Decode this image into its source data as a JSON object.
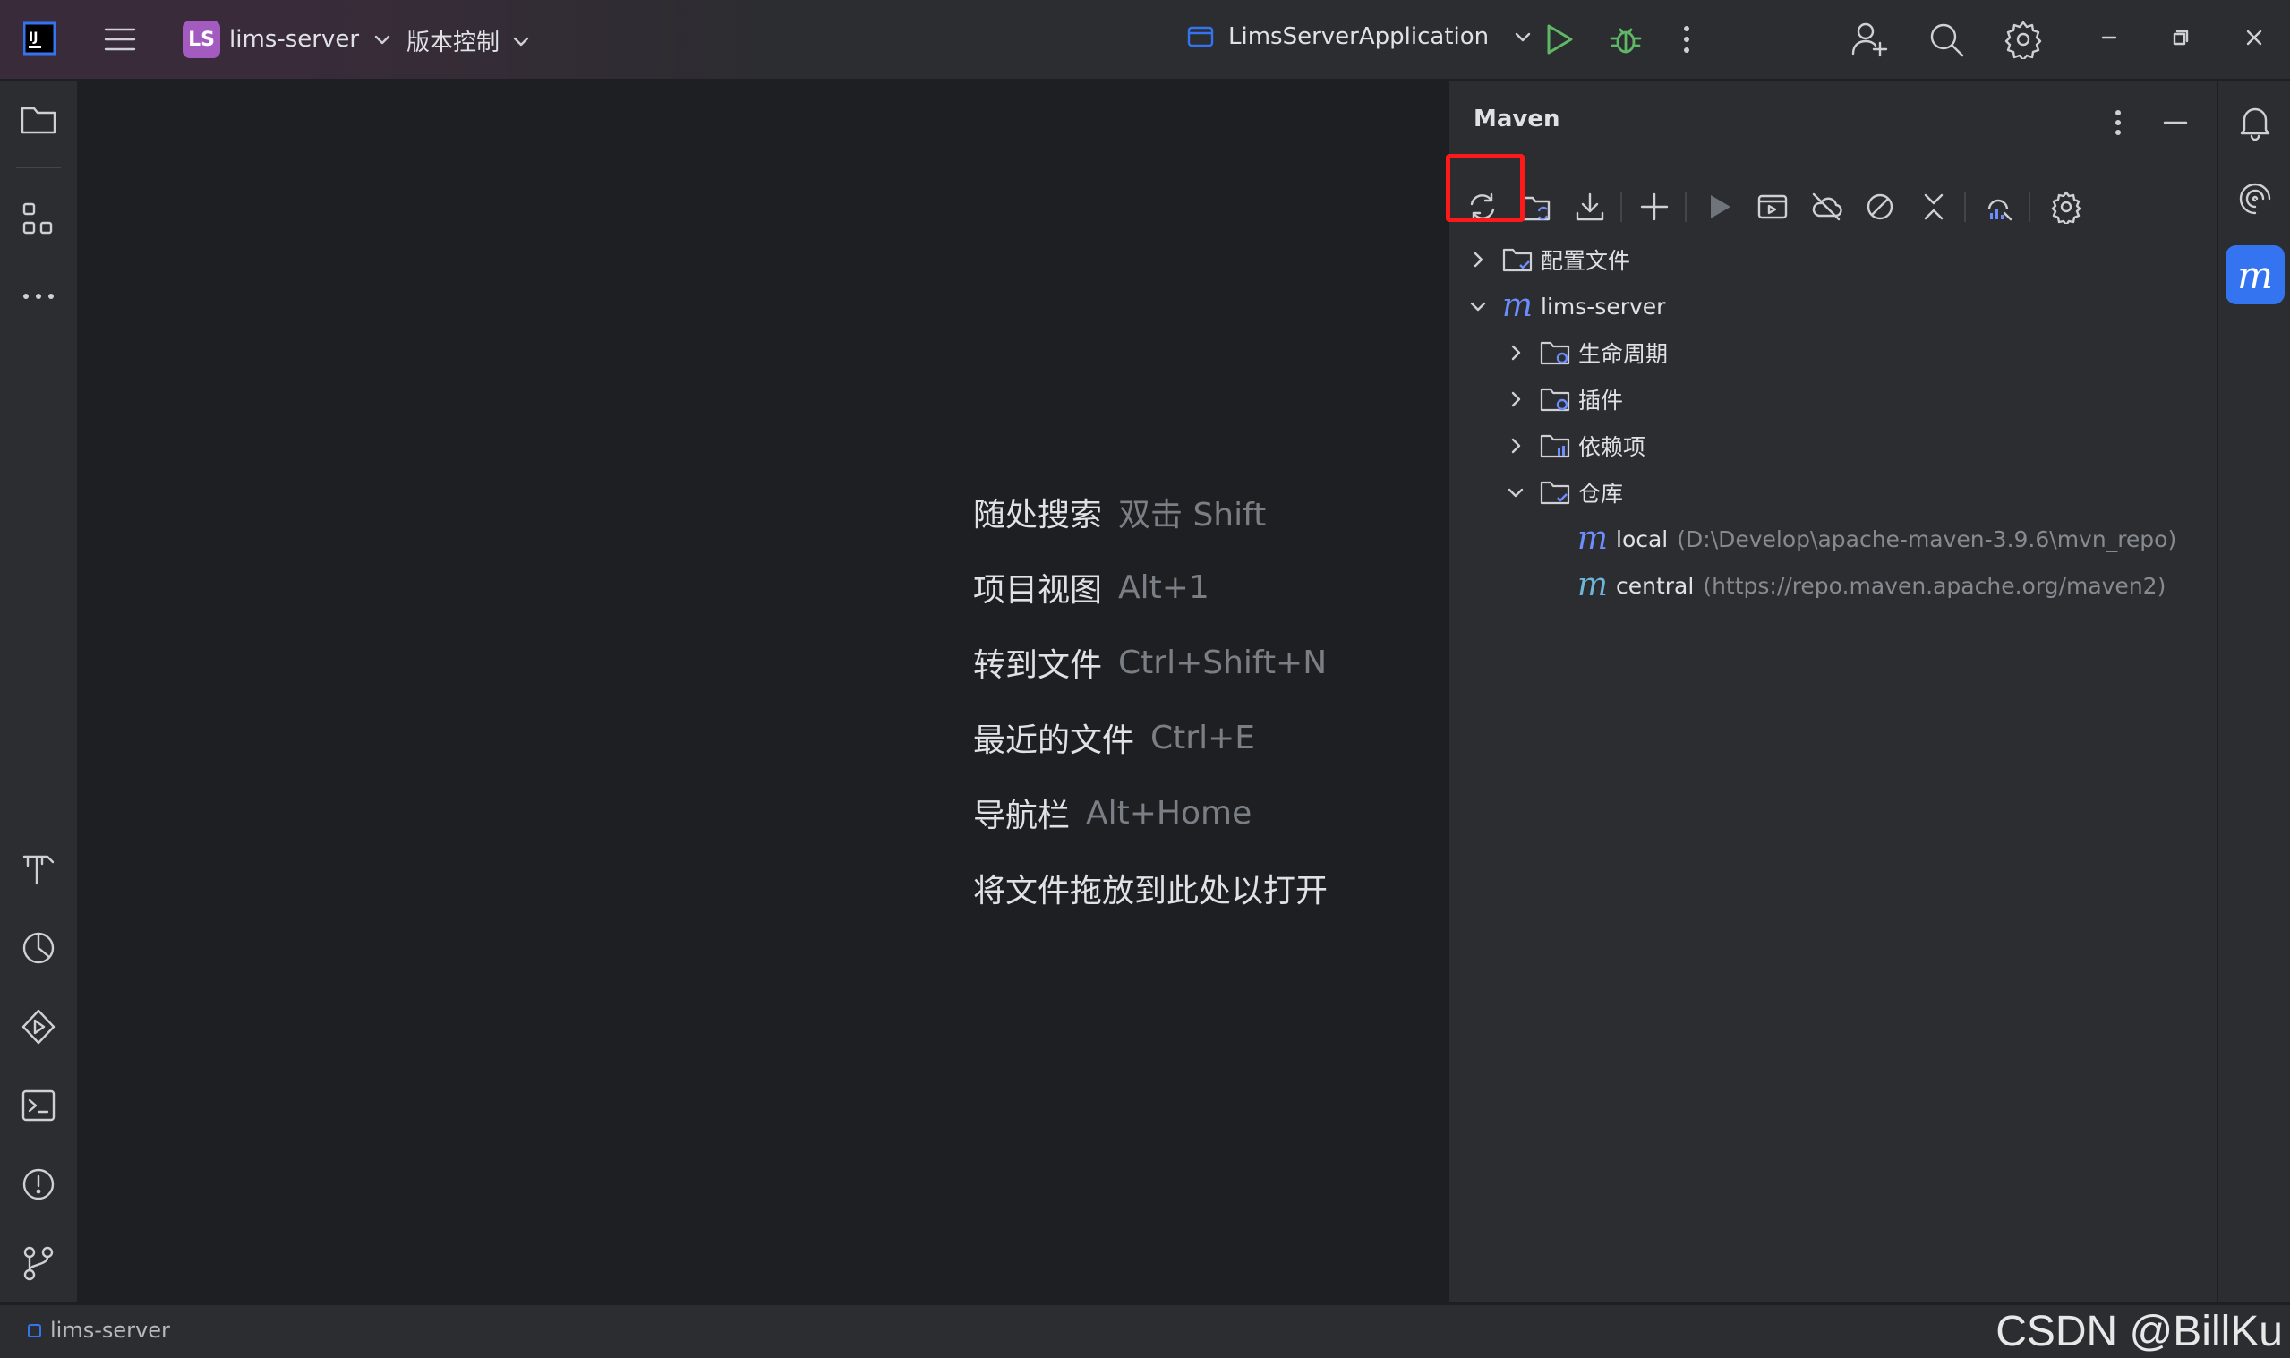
{
  "titlebar": {
    "project_badge": "LS",
    "project_name": "lims-server",
    "vcs_label": "版本控制",
    "run_config": "LimsServerApplication"
  },
  "editor_hints": [
    {
      "action": "随处搜索",
      "shortcut": "双击 Shift"
    },
    {
      "action": "项目视图",
      "shortcut": "Alt+1"
    },
    {
      "action": "转到文件",
      "shortcut": "Ctrl+Shift+N"
    },
    {
      "action": "最近的文件",
      "shortcut": "Ctrl+E"
    },
    {
      "action": "导航栏",
      "shortcut": "Alt+Home"
    },
    {
      "action": "将文件拖放到此处以打开",
      "shortcut": ""
    }
  ],
  "maven": {
    "title": "Maven",
    "tree": {
      "profiles": "配置文件",
      "project": "lims-server",
      "lifecycle": "生命周期",
      "plugins": "插件",
      "dependencies": "依赖项",
      "repositories": "仓库",
      "repo_local_name": "local",
      "repo_local_path": "(D:\\Develop\\apache-maven-3.9.6\\mvn_repo)",
      "repo_central_name": "central",
      "repo_central_url": "(https://repo.maven.apache.org/maven2)"
    }
  },
  "right_strip": {
    "maven_letter": "m"
  },
  "statusbar": {
    "project": "lims-server"
  },
  "watermark": "CSDN @BillKu",
  "colors": {
    "accent": "#3574f0",
    "highlight_box": "#ff1a1a",
    "run_green": "#5fb865",
    "project_badge": "#a35bbf"
  }
}
